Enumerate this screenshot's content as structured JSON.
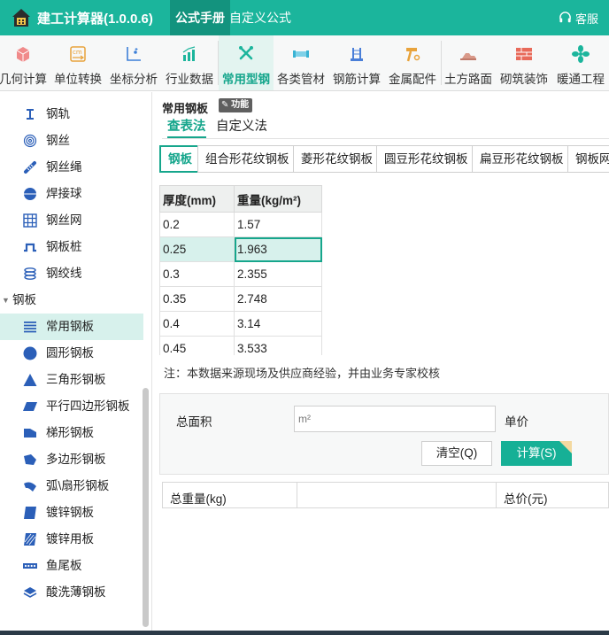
{
  "app": {
    "title": "建工计算器(1.0.0.6)",
    "support_label": "客服"
  },
  "menu": [
    {
      "label": "公式手册",
      "active": true
    },
    {
      "label": "自定义公式",
      "active": false
    }
  ],
  "toolbar": [
    {
      "label": "几何计算",
      "icon": "cube-icon"
    },
    {
      "label": "单位转换",
      "icon": "unit-convert-icon"
    },
    {
      "label": "坐标分析",
      "icon": "coordinate-icon"
    },
    {
      "label": "行业数据",
      "icon": "bar-chart-icon"
    },
    {
      "label": "常用型钢",
      "icon": "wrench-icon",
      "active": true
    },
    {
      "label": "各类管材",
      "icon": "pipe-icon"
    },
    {
      "label": "钢筋计算",
      "icon": "rebar-icon"
    },
    {
      "label": "金属配件",
      "icon": "hammer-icon"
    },
    {
      "label": "土方路面",
      "icon": "road-icon"
    },
    {
      "label": "砌筑装饰",
      "icon": "brick-icon"
    },
    {
      "label": "暖通工程",
      "icon": "fan-icon"
    }
  ],
  "sidebar": {
    "items_top": [
      {
        "label": "钢轨",
        "icon": "rail-icon"
      },
      {
        "label": "钢丝",
        "icon": "wire-coil-icon"
      },
      {
        "label": "钢丝绳",
        "icon": "wire-rope-icon"
      },
      {
        "label": "焊接球",
        "icon": "weld-ball-icon"
      },
      {
        "label": "钢丝网",
        "icon": "wire-mesh-icon"
      },
      {
        "label": "钢板桩",
        "icon": "sheet-pile-icon"
      },
      {
        "label": "钢绞线",
        "icon": "strand-icon"
      }
    ],
    "group": {
      "label": "钢板",
      "expanded": true
    },
    "group_items": [
      {
        "label": "常用钢板",
        "icon": "plate-lines-icon",
        "active": true
      },
      {
        "label": "圆形钢板",
        "icon": "circle-plate-icon"
      },
      {
        "label": "三角形钢板",
        "icon": "triangle-plate-icon"
      },
      {
        "label": "平行四边形钢板",
        "icon": "parallelogram-plate-icon"
      },
      {
        "label": "梯形钢板",
        "icon": "trapezoid-plate-icon"
      },
      {
        "label": "多边形钢板",
        "icon": "polygon-plate-icon"
      },
      {
        "label": "弧\\扇形钢板",
        "icon": "sector-plate-icon"
      },
      {
        "label": "镀锌钢板",
        "icon": "galvanized-plate-icon"
      },
      {
        "label": "镀锌用板",
        "icon": "galvanized-sheet-icon"
      },
      {
        "label": "鱼尾板",
        "icon": "fishplate-icon"
      },
      {
        "label": "酸洗薄钢板",
        "icon": "pickled-sheet-icon"
      }
    ]
  },
  "main": {
    "page_title": "常用钢板",
    "func_badge": "功能",
    "mode_tabs": [
      {
        "label": "查表法",
        "active": true
      },
      {
        "label": "自定义法",
        "active": false
      }
    ],
    "sub_tabs": [
      {
        "label": "钢板",
        "active": true
      },
      {
        "label": "组合形花纹钢板"
      },
      {
        "label": "菱形花纹钢板"
      },
      {
        "label": "圆豆形花纹钢板"
      },
      {
        "label": "扁豆形花纹钢板"
      },
      {
        "label": "钢板网"
      }
    ],
    "table": {
      "headers": [
        "厚度(mm)",
        "重量(kg/m²)"
      ],
      "rows": [
        [
          "0.2",
          "1.57"
        ],
        [
          "0.25",
          "1.963"
        ],
        [
          "0.3",
          "2.355"
        ],
        [
          "0.35",
          "2.748"
        ],
        [
          "0.4",
          "3.14"
        ],
        [
          "0.45",
          "3.533"
        ]
      ],
      "selected_row": 1
    },
    "note": "注：本数据来源现场及供应商经验，并由业务专家校核",
    "form": {
      "area_label": "总面积",
      "area_placeholder": "m²",
      "price_label": "单价",
      "clear_button": "清空(Q)",
      "calc_button": "计算(S)"
    },
    "results": {
      "total_weight_label": "总重量(kg)",
      "total_price_label": "总价(元)"
    }
  },
  "colors": {
    "accent": "#1bb59c",
    "accent_dark": "#16a68c",
    "selected_bg": "#d7f1ec"
  }
}
